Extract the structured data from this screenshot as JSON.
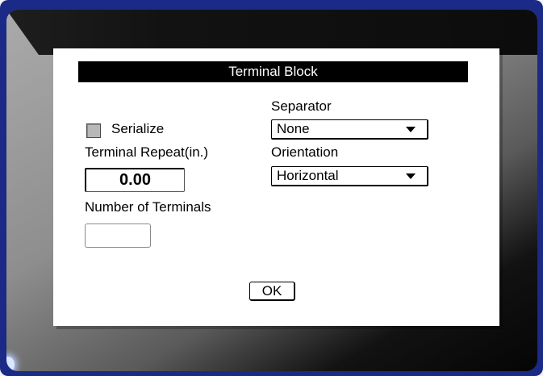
{
  "dialog": {
    "title": "Terminal Block",
    "serialize_label": "Serialize",
    "serialize_checked": false,
    "separator_label": "Separator",
    "separator_value": "None",
    "terminal_repeat_label": "Terminal Repeat(in.)",
    "terminal_repeat_value": "0.00",
    "orientation_label": "Orientation",
    "orientation_value": "Horizontal",
    "number_of_terminals_label": "Number of Terminals",
    "number_of_terminals_value": "",
    "ok_label": "OK"
  },
  "icons": {
    "dropdown_arrow": "chevron-down-icon"
  },
  "colors": {
    "frame": "#1a2a86",
    "title_bar": "#000000",
    "dialog_bg": "#ffffff",
    "checkbox_fill": "#b8b8b8"
  }
}
